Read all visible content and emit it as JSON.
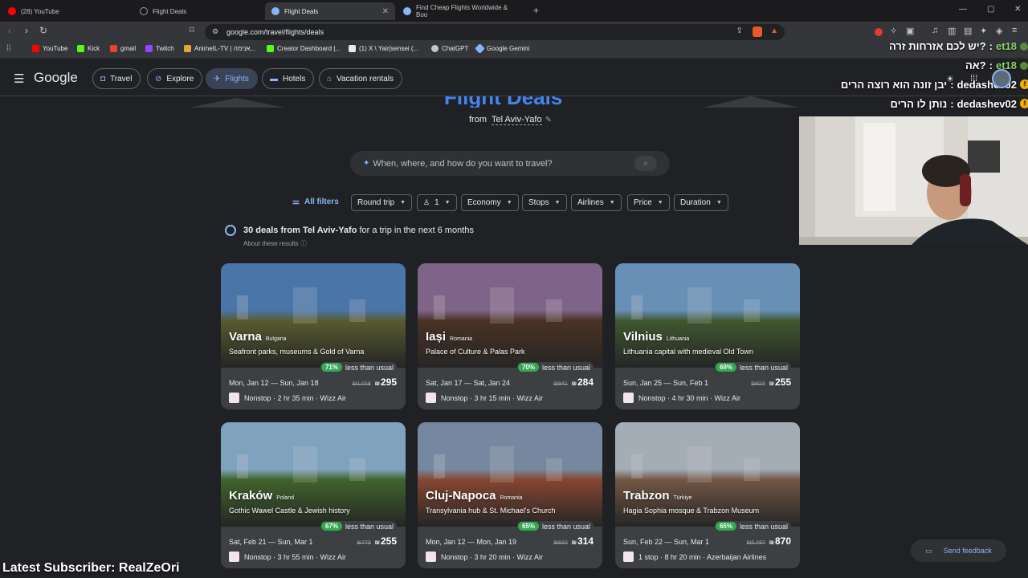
{
  "tabs": [
    {
      "label": "(28) YouTube",
      "color": "#ff0000"
    },
    {
      "label": "Flight Deals",
      "color": "#9aa0a6"
    },
    {
      "label": "Flight Deals",
      "color": "#8ab4f8"
    },
    {
      "label": "Find Cheap Flights Worldwide & Boo",
      "color": "#8ab4f8"
    }
  ],
  "url": "google.com/travel/flights/deals",
  "bookmarks": [
    {
      "label": "YouTube",
      "color": "#ff0000"
    },
    {
      "label": "Kick",
      "color": "#53fc18"
    },
    {
      "label": "gmail",
      "color": "#ea4335"
    },
    {
      "label": "Twitch",
      "color": "#9146ff"
    },
    {
      "label": "AnimeIL-TV | אנימה...",
      "color": "#e8a33d"
    },
    {
      "label": "Creator Dashboard |...",
      "color": "#53fc18"
    },
    {
      "label": "(1) X \\ Yair|sensei (...",
      "color": "#e8eaed"
    },
    {
      "label": "ChatGPT",
      "color": "#c4c7c5"
    },
    {
      "label": "Google Gemini",
      "color": "#8ab4f8"
    }
  ],
  "header": {
    "logo": "Google",
    "nav": [
      "Travel",
      "Explore",
      "Flights",
      "Hotels",
      "Vacation rentals"
    ],
    "selected": "Flights"
  },
  "hero": {
    "title": "Flight Deals",
    "from_label": "from",
    "from_city": "Tel Aviv-Yafo"
  },
  "search": {
    "placeholder": "When, where, and how do you want to travel?"
  },
  "filters": {
    "all": "All filters",
    "items": [
      "Round trip",
      "1",
      "Economy",
      "Stops",
      "Airlines",
      "Price",
      "Duration"
    ]
  },
  "deals": {
    "bold": "30 deals from Tel Aviv-Yafo",
    "rest": " for a trip in the next 6 months",
    "about": "About these results"
  },
  "cards": [
    {
      "city": "Varna",
      "country": "Bulgaria",
      "desc": "Seafront parks, museums & Gold of Varna",
      "pct": "71%",
      "pct_text": "less than usual",
      "dates": "Mon, Jan 12 — Sun, Jan 18",
      "old": "₪1,018",
      "price": "295",
      "cur": "₪",
      "info": "Nonstop · 2 hr 35 min · Wizz Air",
      "sky": "#5a8fcf",
      "ground": "#6b6f3a"
    },
    {
      "city": "Iași",
      "country": "Romania",
      "desc": "Palace of Culture & Palas Park",
      "pct": "70%",
      "pct_text": "less than usual",
      "dates": "Sat, Jan 17 — Sat, Jan 24",
      "old": "₪941",
      "price": "284",
      "cur": "₪",
      "info": "Nonstop · 3 hr 15 min · Wizz Air",
      "sky": "#9c7ba8",
      "ground": "#5a3d2c"
    },
    {
      "city": "Vilnius",
      "country": "Lithuania",
      "desc": "Lithuania capital with medieval Old Town",
      "pct": "69%",
      "pct_text": "less than usual",
      "dates": "Sun, Jan 25 — Sun, Feb 1",
      "old": "₪824",
      "price": "255",
      "cur": "₪",
      "info": "Nonstop · 4 hr 30 min · Wizz Air",
      "sky": "#7fb0e0",
      "ground": "#4d6b3a"
    },
    {
      "city": "Kraków",
      "country": "Poland",
      "desc": "Gothic Wawel Castle & Jewish history",
      "pct": "67%",
      "pct_text": "less than usual",
      "dates": "Sat, Feb 21 — Sun, Mar 1",
      "old": "₪773",
      "price": "255",
      "cur": "₪",
      "info": "Nonstop · 3 hr 55 min · Wizz Air",
      "sky": "#9cc6ea",
      "ground": "#4f7a35"
    },
    {
      "city": "Cluj-Napoca",
      "country": "Romania",
      "desc": "Transylvania hub & St. Michael's Church",
      "pct": "65%",
      "pct_text": "less than usual",
      "dates": "Mon, Jan 12 — Mon, Jan 19",
      "old": "₪910",
      "price": "314",
      "cur": "₪",
      "info": "Nonstop · 3 hr 20 min · Wizz Air",
      "sky": "#8fa7c4",
      "ground": "#a4563d"
    },
    {
      "city": "Trabzon",
      "country": "Türkiye",
      "desc": "Hagia Sophia mosque & Trabzon Museum",
      "pct": "65%",
      "pct_text": "less than usual",
      "dates": "Sun, Feb 22 — Sun, Mar 1",
      "old": "₪2,487",
      "price": "870",
      "cur": "₪",
      "info": "1 stop · 8 hr 20 min · Azerbaijan Airlines",
      "sky": "#c7d3de",
      "ground": "#8c6a55"
    }
  ],
  "chat": [
    {
      "user": "et18",
      "msg": "יש לכם אזרחות זרה?",
      "badge": false
    },
    {
      "user": "et18",
      "msg": "אה?",
      "badge": false
    },
    {
      "user": "dedashev02",
      "msg": "יבן זונה הוא רוצה הרים",
      "badge": true
    },
    {
      "user": "dedashev02",
      "msg": "נותן לו הרים",
      "badge": true
    }
  ],
  "latest_subscriber": "Latest Subscriber: RealZeOri",
  "feedback": "Send feedback"
}
